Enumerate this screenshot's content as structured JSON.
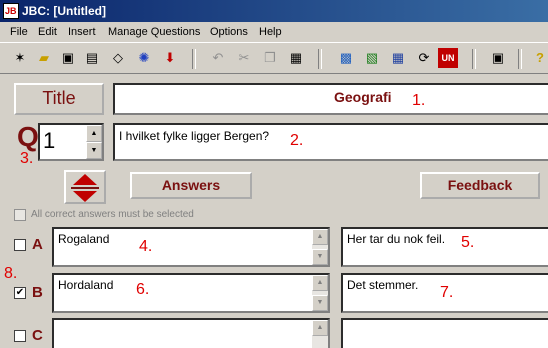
{
  "window": {
    "title": "JBC: [Untitled]",
    "icon_label": "JB"
  },
  "menu": [
    "File",
    "Edit",
    "Insert",
    "Manage Questions",
    "Options",
    "Help"
  ],
  "toolbar_icons": [
    "new-file-icon",
    "open-folder-icon",
    "save-icon",
    "save-as-icon",
    "eraser-icon",
    "web-export-icon",
    "arrow-down-icon",
    "undo-icon",
    "cut-icon",
    "copy-icon",
    "paste-icon",
    "web-page-icon",
    "export-icon",
    "grid-icon",
    "refresh-icon",
    "unicode-icon",
    "monitor-icon",
    "help-icon"
  ],
  "title_button": "Title",
  "title_value": "Geografi",
  "q_letter": "Q",
  "question_number": "1",
  "question_text": "I hvilket fylke ligger Bergen?",
  "answers_button": "Answers",
  "feedback_button": "Feedback",
  "all_correct_label": "All correct answers must be selected",
  "answers": [
    {
      "letter": "A",
      "text": "Rogaland",
      "feedback": "Her tar du nok feil.",
      "checked": false
    },
    {
      "letter": "B",
      "text": "Hordaland",
      "feedback": "Det stemmer.",
      "checked": true
    },
    {
      "letter": "C",
      "text": "",
      "feedback": "",
      "checked": false
    }
  ],
  "checkmark": "✔",
  "annotations": [
    "1.",
    "2.",
    "3.",
    "4.",
    "5.",
    "6.",
    "7.",
    "8."
  ],
  "colors": {
    "title_bar": "#0a246a",
    "annotation": "#e00000",
    "button_text": "#7a1010"
  }
}
